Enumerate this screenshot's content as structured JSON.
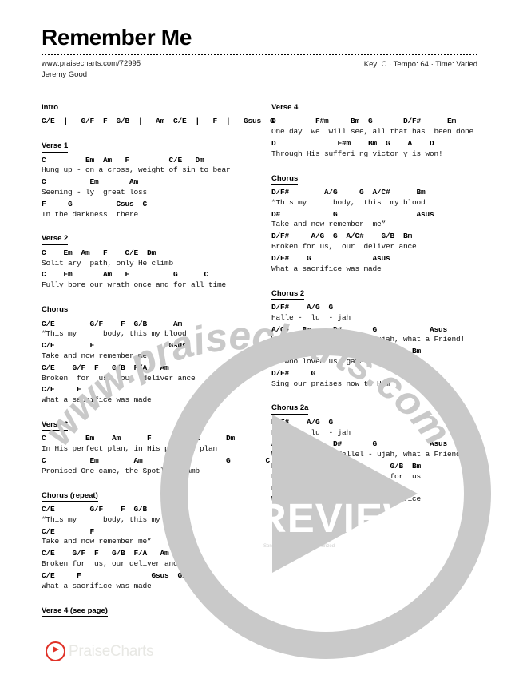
{
  "document": {
    "title": "Remember Me",
    "url": "www.praisecharts.com/72995",
    "author": "Jeremy Good",
    "meta": "Key: C · Tempo: 64 · Time: Varied",
    "key": "C",
    "tempo": "64",
    "time": "Varied",
    "copyright": "Song No. 7127539. Unauthorized"
  },
  "overlay": {
    "watermark": "www.praisecharts.com",
    "preview_label": "PREVIEW",
    "watermark_color": "#c9c9c9",
    "brand_red": "#e03127"
  },
  "footer": {
    "logo_text": "PraiseCharts",
    "logo_icon": "play-circle-icon"
  },
  "left_column": [
    {
      "label": "Intro",
      "lines": [
        {
          "chords": "C/E  |   G/F  F  G/B  |   Am  C/E  |   F  |   Gsus  G",
          "lyrics": ""
        }
      ]
    },
    {
      "label": "Verse 1",
      "lines": [
        {
          "chords": "C         Em  Am   F         C/E   Dm",
          "lyrics": "Hung up - on a cross, weight of sin to bear"
        },
        {
          "chords": "C          Em       Am",
          "lyrics": "Seeming - ly  great loss"
        },
        {
          "chords": "F     G          Csus  C",
          "lyrics": "In the darkness  there"
        }
      ]
    },
    {
      "label": "Verse 2",
      "lines": [
        {
          "chords": "C    Em  Am   F    C/E  Dm",
          "lyrics": "Solit ary  path, only He climb"
        },
        {
          "chords": "C    Em       Am   F          G      C",
          "lyrics": "Fully bore our wrath once and for all time"
        }
      ]
    },
    {
      "label": "Chorus",
      "lines": [
        {
          "chords": "C/E        G/F    F  G/B      Am",
          "lyrics": "“This my      body, this my blood"
        },
        {
          "chords": "C/E        F                 Gsus",
          "lyrics": "Take and now remember me”"
        },
        {
          "chords": "C/E    G/F  F   G/B  F/A   Am",
          "lyrics": "Broken  for  us,  our  deliver ance"
        },
        {
          "chords": "C/E     F",
          "lyrics": "What a sacrifice was made"
        }
      ]
    },
    {
      "label": "Verse 3",
      "lines": [
        {
          "chords": "C         Em    Am      F        C/E      Dm",
          "lyrics": "In His perfect plan, in His perfect plan"
        },
        {
          "chords": "C          Em        Am       F           G        C",
          "lyrics": "Promised One came, the Spotless Lamb"
        }
      ]
    },
    {
      "label": "Chorus (repeat)",
      "lines": [
        {
          "chords": "C/E        G/F    F  G/B      Am",
          "lyrics": "“This my      body, this my blood"
        },
        {
          "chords": "C/E        F                 Gsus",
          "lyrics": "Take and now remember me”"
        },
        {
          "chords": "C/E    G/F  F   G/B  F/A   Am",
          "lyrics": "Broken for  us, our deliver ance"
        },
        {
          "chords": "C/E     F                Gsus  G/A",
          "lyrics": "What a sacrifice was made"
        }
      ]
    },
    {
      "label": "Verse 4 (see page)",
      "lines": []
    }
  ],
  "right_column": [
    {
      "label": "Verse 4",
      "lines": [
        {
          "chords": "D         F#m     Bm  G       D/F#      Em",
          "lyrics": "One day  we  will see, all that has  been done"
        },
        {
          "chords": "D              F#m    Bm  G    A    D",
          "lyrics": "Through His sufferi ng victor y is won!"
        }
      ]
    },
    {
      "label": "Chorus",
      "lines": [
        {
          "chords": "D/F#        A/G     G  A/C#      Bm",
          "lyrics": "“This my      body,  this  my blood"
        },
        {
          "chords": "D#            G                  Asus",
          "lyrics": "Take and now remember  me”"
        },
        {
          "chords": "D/F#     A/G  G  A/C#    G/B  Bm",
          "lyrics": "Broken for us,  our  deliver ance"
        },
        {
          "chords": "D/F#    G              Asus",
          "lyrics": "What a sacrifice was made"
        }
      ]
    },
    {
      "label": "Chorus 2",
      "lines": [
        {
          "chords": "D/F#    A/G  G",
          "lyrics": "Halle -  lu  - jah"
        },
        {
          "chords": "A/C#   Bm     D#       G            Asus",
          "lyrics": "What a Savior! Hallel - ujah, what a Friend!"
        },
        {
          "chords": "D/F#     A/G  G  A/C#      G/B  Bm",
          "lyrics": "He who loved us, gave Him  for  us"
        },
        {
          "chords": "D/F#     G",
          "lyrics": "Sing our praises now to Him"
        }
      ]
    },
    {
      "label": "Chorus 2a",
      "lines": [
        {
          "chords": "D/F#    A/G  G",
          "lyrics": "Halle -  lu  - jah"
        },
        {
          "chords": "A/C#   Bm     D#       G            Asus",
          "lyrics": "What a Savior! Hallel - ujah, what a Friend!"
        },
        {
          "chords": "D/F#     A/G  G  A/C#      G/B  Bm",
          "lyrics": "He who loved us, gave Him  for  us"
        },
        {
          "chords": "D/F#     G          D/F#    G",
          "lyrics": "What a sacrifice, what a sacrifice"
        }
      ]
    }
  ]
}
